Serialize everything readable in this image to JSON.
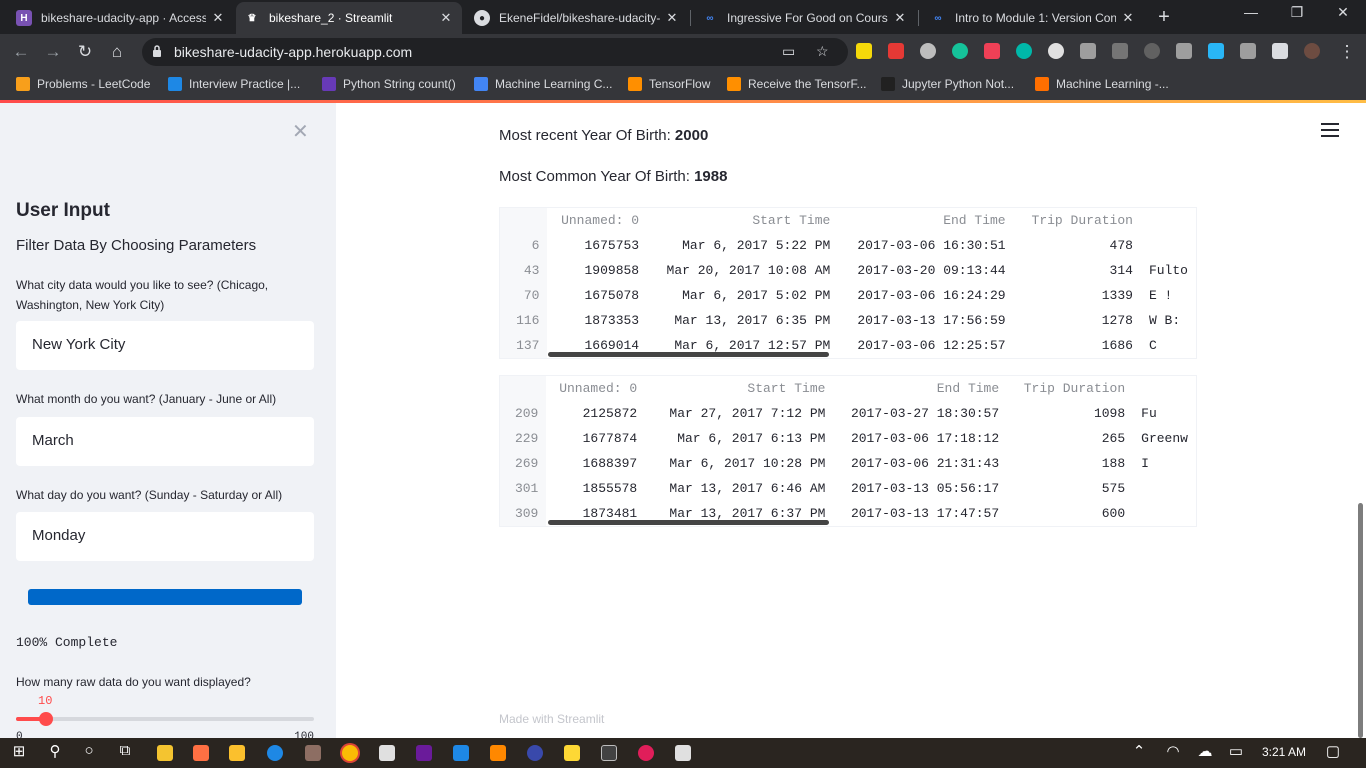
{
  "browser": {
    "tabs": [
      {
        "title": "bikeshare-udacity-app · Access",
        "icon_color": "#7952b3",
        "icon_char": "H"
      },
      {
        "title": "bikeshare_2 · Streamlit",
        "icon_color": "#35363a",
        "icon_char": "♛"
      },
      {
        "title": "EkeneFidel/bikeshare-udacity-a",
        "icon_color": "#dadce0",
        "icon_char": "●"
      },
      {
        "title": "Ingressive For Good on Course",
        "icon_color": "#4285f4",
        "icon_char": "∞"
      },
      {
        "title": "Intro to Module 1: Version Con",
        "icon_color": "#4285f4",
        "icon_char": "∞"
      }
    ],
    "new_tab_glyph": "+",
    "window_controls": [
      "—",
      "❐",
      "✕"
    ],
    "url": "bikeshare-udacity-app.herokuapp.com",
    "bookmarks": [
      {
        "label": "Problems - LeetCode",
        "color": "#f89f1b"
      },
      {
        "label": "Interview Practice |...",
        "color": "#1e88e5"
      },
      {
        "label": "Python String count()",
        "color": "#673ab7"
      },
      {
        "label": "Machine Learning C...",
        "color": "#4285f4"
      },
      {
        "label": "TensorFlow",
        "color": "#ff8f00"
      },
      {
        "label": "Receive the TensorF...",
        "color": "#ff8f00"
      },
      {
        "label": "Jupyter Python Not...",
        "color": "#212121"
      },
      {
        "label": "Machine Learning -...",
        "color": "#ff6f00"
      }
    ]
  },
  "sidebar": {
    "close_glyph": "✕",
    "title": "User Input",
    "subtitle": "Filter Data By Choosing Parameters",
    "city_label": "What city data would you like to see? (Chicago, Washington, New York City)",
    "city_value": "New York City",
    "month_label": "What month do you want? (January - June or All)",
    "month_value": "March",
    "day_label": "What day do you want? (Sunday - Saturday or All)",
    "day_value": "Monday",
    "progress_percent": 100,
    "progress_text": "100% Complete",
    "slider_label": "How many raw data do you want displayed?",
    "slider_value": "10",
    "slider_min": "0",
    "slider_max": "100"
  },
  "main": {
    "recent_birth_label": "Most recent Year Of Birth:",
    "recent_birth_value": "2000",
    "common_birth_label": "Most Common Year Of Birth:",
    "common_birth_value": "1988",
    "columns": [
      "",
      "Unnamed: 0",
      "Start Time",
      "End Time",
      "Trip Duration",
      ""
    ],
    "table1": [
      [
        "6",
        "1675753",
        "Mar 6, 2017 5:22 PM",
        "2017-03-06 16:30:51",
        "478",
        ""
      ],
      [
        "43",
        "1909858",
        "Mar 20, 2017 10:08 AM",
        "2017-03-20 09:13:44",
        "314",
        "Fulto"
      ],
      [
        "70",
        "1675078",
        "Mar 6, 2017 5:02 PM",
        "2017-03-06 16:24:29",
        "1339",
        "E !"
      ],
      [
        "116",
        "1873353",
        "Mar 13, 2017 6:35 PM",
        "2017-03-13 17:56:59",
        "1278",
        "W B:"
      ],
      [
        "137",
        "1669014",
        "Mar 6, 2017 12:57 PM",
        "2017-03-06 12:25:57",
        "1686",
        "C"
      ]
    ],
    "table2": [
      [
        "209",
        "2125872",
        "Mar 27, 2017 7:12 PM",
        "2017-03-27 18:30:57",
        "1098",
        "Fu"
      ],
      [
        "229",
        "1677874",
        "Mar 6, 2017 6:13 PM",
        "2017-03-06 17:18:12",
        "265",
        "Greenw"
      ],
      [
        "269",
        "1688397",
        "Mar 6, 2017 10:28 PM",
        "2017-03-06 21:31:43",
        "188",
        "I"
      ],
      [
        "301",
        "1855578",
        "Mar 13, 2017 6:46 AM",
        "2017-03-13 05:56:17",
        "575",
        ""
      ],
      [
        "309",
        "1873481",
        "Mar 13, 2017 6:37 PM",
        "2017-03-13 17:47:57",
        "600",
        ""
      ]
    ],
    "footer": "Made with Streamlit"
  },
  "taskbar": {
    "time": "3:21 AM"
  }
}
